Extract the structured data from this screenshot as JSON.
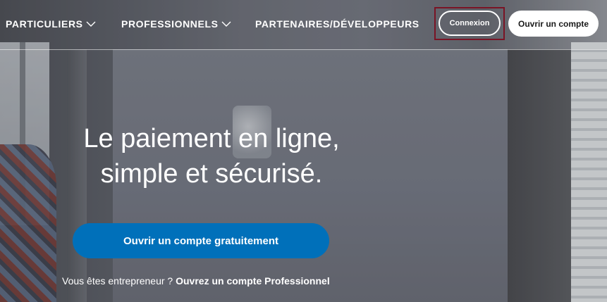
{
  "nav": {
    "items": [
      {
        "label": "PARTICULIERS",
        "icon": "chevron-down-icon"
      },
      {
        "label": "PROFESSIONNELS",
        "icon": "chevron-down-icon"
      },
      {
        "label": "PARTENAIRES/DÉVELOPPEURS"
      }
    ],
    "login_label": "Connexion",
    "signup_label": "Ouvrir un compte"
  },
  "hero": {
    "headline_line1": "Le paiement en ligne,",
    "headline_line2": "simple et sécurisé.",
    "cta_label": "Ouvrir un compte gratuitement",
    "sub_text": "Vous êtes entrepreneur ? ",
    "sub_link": "Ouvrez un compte Professionnel"
  },
  "colors": {
    "cta_blue": "#0070ba",
    "highlight_border": "#7a1425",
    "text": "#ffffff"
  }
}
